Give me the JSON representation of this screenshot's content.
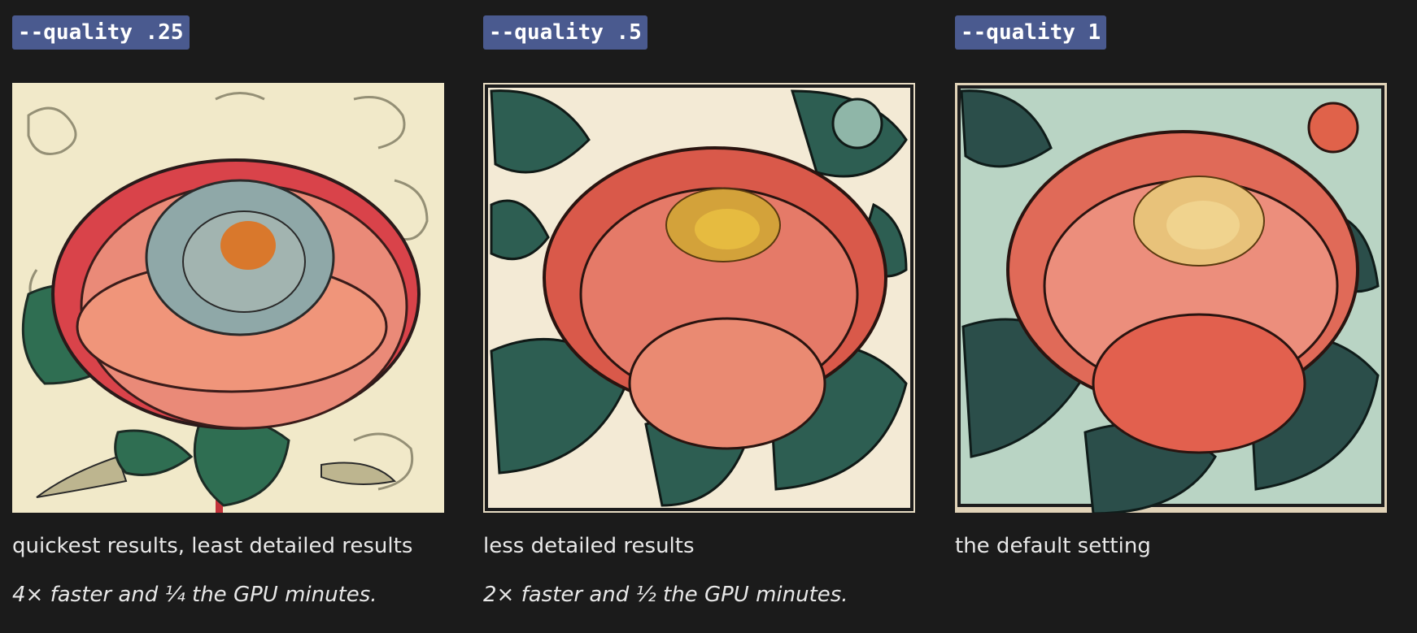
{
  "colors": {
    "background": "#1b1b1b",
    "tag_background": "#4a5a8f",
    "text": "#e8e8e8"
  },
  "columns": [
    {
      "tag": "--quality .25",
      "description": "quickest results, least detailed results",
      "note": "4× faster and ¼ the GPU minutes.",
      "image_subject": "peony illustration, pale cream background"
    },
    {
      "tag": "--quality .5",
      "description": "less detailed results",
      "note": "2× faster and ½ the GPU minutes.",
      "image_subject": "peony illustration, dark leaf background"
    },
    {
      "tag": "--quality 1",
      "description": "the default setting",
      "note": "",
      "image_subject": "peony illustration, detailed linework"
    }
  ]
}
